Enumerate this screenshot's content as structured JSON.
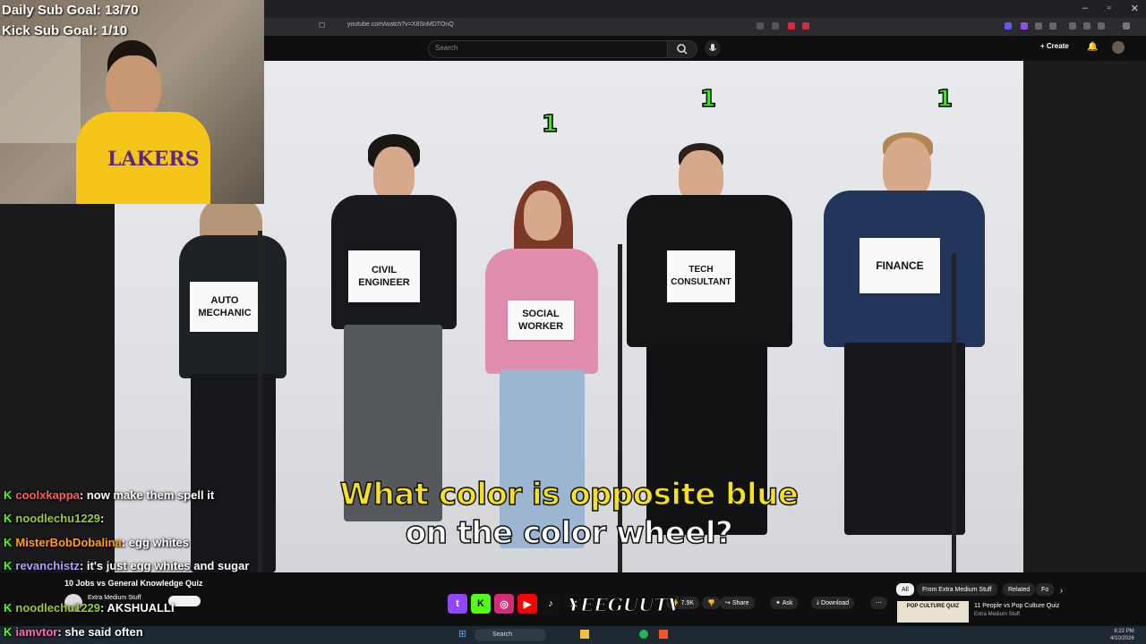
{
  "overlay": {
    "daily_sub_goal": "Daily Sub Goal: 13/70",
    "kick_sub_goal": "Kick Sub Goal: 1/10",
    "signature": "YEEGUUTV"
  },
  "browser": {
    "url": "youtube.com/watch?v=X8SnMDTOnQ"
  },
  "youtube": {
    "search_placeholder": "Search",
    "create_label": "Create",
    "video_title": "10 Jobs vs General Knowledge Quiz",
    "channel_name": "Extra Medium Stuff",
    "actions": {
      "like_count": "7.9K",
      "share_label": "Share",
      "ask_label": "Ask",
      "download_label": "Download"
    },
    "chips": [
      "All",
      "From Extra Medium Stuff",
      "Related",
      "Fo"
    ],
    "related": {
      "thumb_text": "POP CULTURE QUIZ",
      "title": "11 People vs Pop Culture Quiz",
      "channel": "Extra Medium Stuff"
    }
  },
  "video": {
    "scores": [
      "1",
      "1",
      "1"
    ],
    "signs": {
      "auto_mechanic": "AUTO MECHANIC",
      "civil_engineer": "CIVIL ENGINEER",
      "social_worker": "SOCIAL WORKER",
      "tech_consultant": "TECH CONSULTANT",
      "finance": "FINANCE"
    },
    "subtitle_line1": "What color is opposite blue",
    "subtitle_line2": "on the color wheel?"
  },
  "chat": [
    {
      "user": "coolxkappa",
      "color": "#ff5b5b",
      "text": ": now make them spell it"
    },
    {
      "user": "noodlechu1229",
      "color": "#9acd32",
      "text": ":"
    },
    {
      "user": "MisterBobDobalina",
      "color": "#ff9f1c",
      "text": ": egg whites"
    },
    {
      "user": "revanchistz",
      "color": "#b0a0ff",
      "text": ": it's just egg whites and sugar"
    },
    {
      "user": "noodlechu1229",
      "color": "#9acd32",
      "text": ": AKSHUALLI"
    },
    {
      "user": "iamvtor",
      "color": "#ff69b4",
      "text": ": she said often"
    }
  ],
  "taskbar": {
    "search_label": "Search",
    "time": "8:22 PM",
    "date": "4/10/2026"
  }
}
